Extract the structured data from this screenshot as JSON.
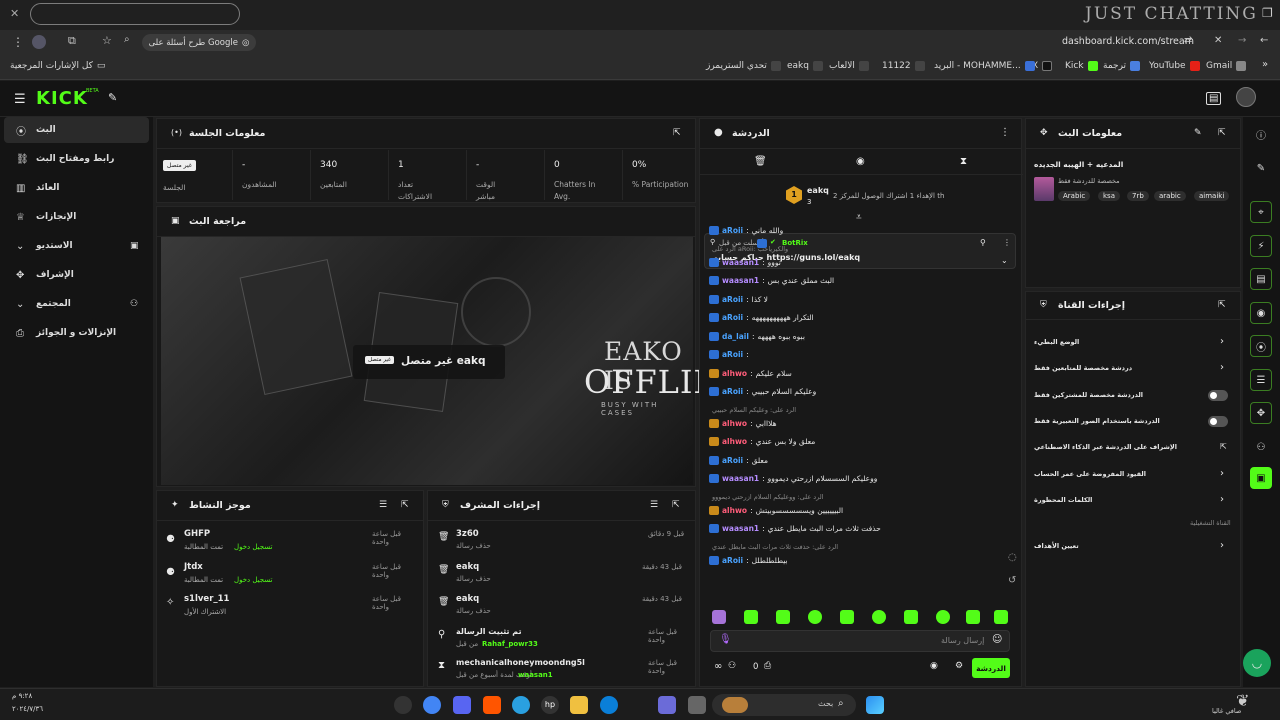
{
  "browser": {
    "url": "dashboard.kick.com/stream",
    "google_prompt": "طرح أسئلة على Google",
    "all_bookmarks": "كل الإشارات المرجعية",
    "bookmarks": [
      "Gmail",
      "YouTube",
      "ترجمة",
      "Kick",
      "X",
      "البريد - MOHAMME...",
      "11122",
      "الالعاب",
      "eakq",
      "تحدي الستريمرز"
    ],
    "overlay_text": "JUST CHATTING",
    "top_right": "eakq"
  },
  "kick": {
    "logo": "KICK",
    "logo_sup": "BETA"
  },
  "nav": {
    "items": [
      "البث",
      "رابط ومفتاح البث",
      "العائد",
      "الإنجازات",
      "الاستديو",
      "الإشراف",
      "المجتمع",
      "الإنزالات و الجوائز"
    ]
  },
  "session": {
    "title": "معلومات الجلسة",
    "stats": [
      {
        "value": "غير متصل",
        "label": "الجلسة"
      },
      {
        "value": "-",
        "label": "المشاهدون"
      },
      {
        "value": "340",
        "label": "المتابعين"
      },
      {
        "value": "1",
        "label": "تعداد الاشتراكات"
      },
      {
        "value": "-",
        "label": "الوقت مباشر"
      },
      {
        "value": "0",
        "label": "Chatters In Avg."
      },
      {
        "value": "0%",
        "label": "% Participation"
      }
    ]
  },
  "preview": {
    "title": "مراجعة البث",
    "offline_text": "غير متصل eakq",
    "offline_tag": "غير متصل",
    "art_line1": "EAKO IS",
    "art_line2": "OFFLINE",
    "art_line3": "BUSY WITH CASES"
  },
  "activity": {
    "title": "موجز النشاط",
    "items": [
      {
        "user": "GHFP",
        "sub": "تمت المطالبة",
        "action": "تسجيل دخول",
        "time": "قبل ساعة واحدة"
      },
      {
        "user": "Jtdx",
        "sub": "تمت المطالبة",
        "action": "تسجيل دخول",
        "time": "قبل ساعة واحدة"
      },
      {
        "user": "s1lver_11",
        "sub": "الاشتراك الأول",
        "action": "",
        "time": "قبل ساعة واحدة"
      }
    ]
  },
  "mod_actions": {
    "title": "إجراءات المشرف",
    "items": [
      {
        "user": "3z60",
        "sub": "حذف رسالة",
        "time": "قبل 9 دقائق"
      },
      {
        "user": "eakq",
        "sub": "حذف رسالة",
        "time": "قبل 43 دقيقة"
      },
      {
        "user": "eakq",
        "sub": "حذف رسالة",
        "time": "قبل 43 دقيقة"
      },
      {
        "user": "تم تثبيت الرسالة",
        "sub": "من قبل",
        "extra": "Rahaf_powr33",
        "time": "قبل ساعة واحدة"
      },
      {
        "user": "mechanicalhoneymoondng5l",
        "sub": "أوقف لمدة أسبوع من قبل",
        "extra": "waasan1",
        "time": "قبل ساعة واحدة"
      }
    ]
  },
  "chat": {
    "title": "الدردشة",
    "goal_user": "eakq",
    "goal_num": "3",
    "goal_rank": "1",
    "goal_text": "الإهداء 1 اشتراك الوصول للمركز 2 th",
    "pinned_by": "أرسلت من قبل",
    "pinned_user": "BotRix",
    "pinned_msg": "حياكم حسابي https://guns.lol/eakq",
    "messages": [
      {
        "user": "aRoii",
        "cls": "u-a",
        "text": "والله ماني",
        "reply": ""
      },
      {
        "user": "",
        "cls": "",
        "text": "",
        "reply": "الرد على aRoii: والكيرياحب"
      },
      {
        "user": "waasan1",
        "cls": "u-w",
        "text": "تووو",
        "reply": ""
      },
      {
        "user": "waasan1",
        "cls": "u-w",
        "text": "البث مملق عندي بس",
        "reply": ""
      },
      {
        "user": "aRoii",
        "cls": "u-a",
        "text": "لا كذا",
        "reply": ""
      },
      {
        "user": "aRoii",
        "cls": "u-a",
        "text": "التكرار ههههههههههه",
        "reply": ""
      },
      {
        "user": "da_lail",
        "cls": "u-d",
        "text": "ببوه ببوه ههههه",
        "reply": ""
      },
      {
        "user": "aRoii",
        "cls": "u-a",
        "text": "",
        "reply": ""
      },
      {
        "user": "alhwo",
        "cls": "u-r",
        "text": "سلام عليكم",
        "reply": ""
      },
      {
        "user": "aRoii",
        "cls": "u-a",
        "text": "وعليكم السلام حبيبي",
        "reply": ""
      },
      {
        "user": "",
        "cls": "",
        "text": "",
        "reply": "الرد على: وعليكم السلام حبيبي"
      },
      {
        "user": "alhwo",
        "cls": "u-r",
        "text": "هلااابي",
        "reply": ""
      },
      {
        "user": "alhwo",
        "cls": "u-r",
        "text": "معلق ولا بس عندي",
        "reply": ""
      },
      {
        "user": "aRoii",
        "cls": "u-a",
        "text": "معلق",
        "reply": ""
      },
      {
        "user": "waasan1",
        "cls": "u-w",
        "text": "ووعليكم السسسلام ازرحتي ديمووو",
        "reply": ""
      },
      {
        "user": "",
        "cls": "",
        "text": "",
        "reply": "الرد على: ووعليكم السلام ازرحتي ديمووو"
      },
      {
        "user": "alhwo",
        "cls": "u-r",
        "text": "البيييييين ويسسسسسوبيتش",
        "reply": ""
      },
      {
        "user": "waasan1",
        "cls": "u-w",
        "text": "حذفت ثلاث مرات البث مايطل عندي",
        "reply": ""
      },
      {
        "user": "",
        "cls": "",
        "text": "",
        "reply": "الرد على: حذفت ثلاث مرات البث مايطل عندي"
      },
      {
        "user": "aRoii",
        "cls": "u-a",
        "text": "بيطلطلطلل",
        "reply": ""
      }
    ],
    "send_placeholder": "إرسال رسالة",
    "send_button": "الدردشة",
    "bottom_count": "0"
  },
  "stream_info": {
    "title": "معلومات البث",
    "stream_title": "المدعيه + الهيبه الجديده",
    "category": "مخصصة للدردشة فقط",
    "tags": [
      "aimaiki",
      "arabic",
      "7rb",
      "ksa",
      "Arabic"
    ]
  },
  "channel_actions": {
    "title": "إجراءات القناة",
    "items": [
      {
        "label": "الوضع البطيء",
        "control": "arrow"
      },
      {
        "label": "دردشة مخصصة للمتابعين فقط",
        "control": "arrow"
      },
      {
        "label": "الدردشة مخصصة للمشتركين فقط",
        "control": "toggle"
      },
      {
        "label": "الدردشة باستخدام الصور التعبيرية فقط",
        "control": "toggle"
      },
      {
        "label": "الإشراف على الدردشة عبر الذكاء الاصطناعي",
        "control": "link"
      },
      {
        "label": "القيود المفروضة على عمر الحساب",
        "control": "arrow"
      },
      {
        "label": "الكلمات المحظورة",
        "control": "arrow"
      }
    ],
    "section_label": "القناة التشغيلية",
    "goals": "تعيين الأهداف"
  },
  "taskbar": {
    "search": "بحث",
    "time": "٩:٢٨ م",
    "date": "٢٠٢٤/٧/٣٦",
    "user": "صافي غاليا"
  }
}
